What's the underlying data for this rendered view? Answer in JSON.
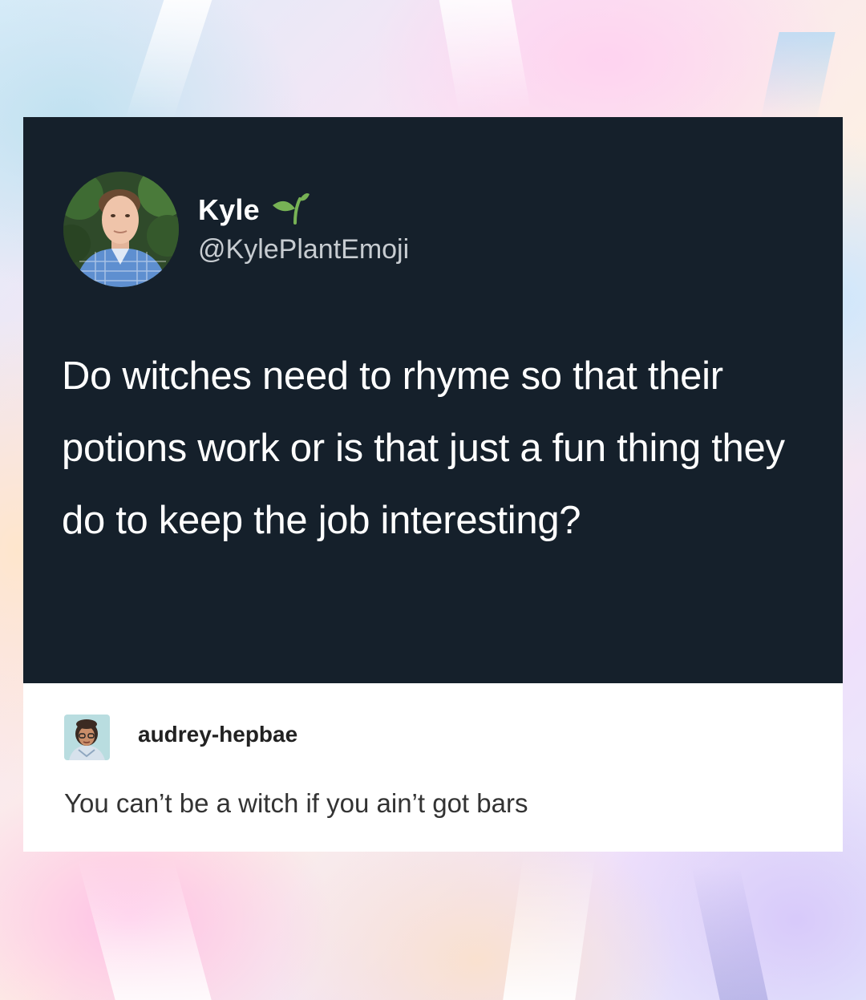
{
  "tweet": {
    "display_name": "Kyle",
    "handle": "@KylePlantEmoji",
    "text": "Do witches need to rhyme so that their potions work or is that just a fun thing they do to keep the job interesting?",
    "name_emoji": "sprout-icon"
  },
  "reply": {
    "username": "audrey-hepbae",
    "text": "You can’t be a witch if you ain’t got bars"
  },
  "colors": {
    "tweet_background": "#15202b",
    "tweet_text": "#ffffff",
    "handle_text": "#c7ccd1",
    "reply_background": "#ffffff",
    "sprout_green": "#77b255"
  }
}
